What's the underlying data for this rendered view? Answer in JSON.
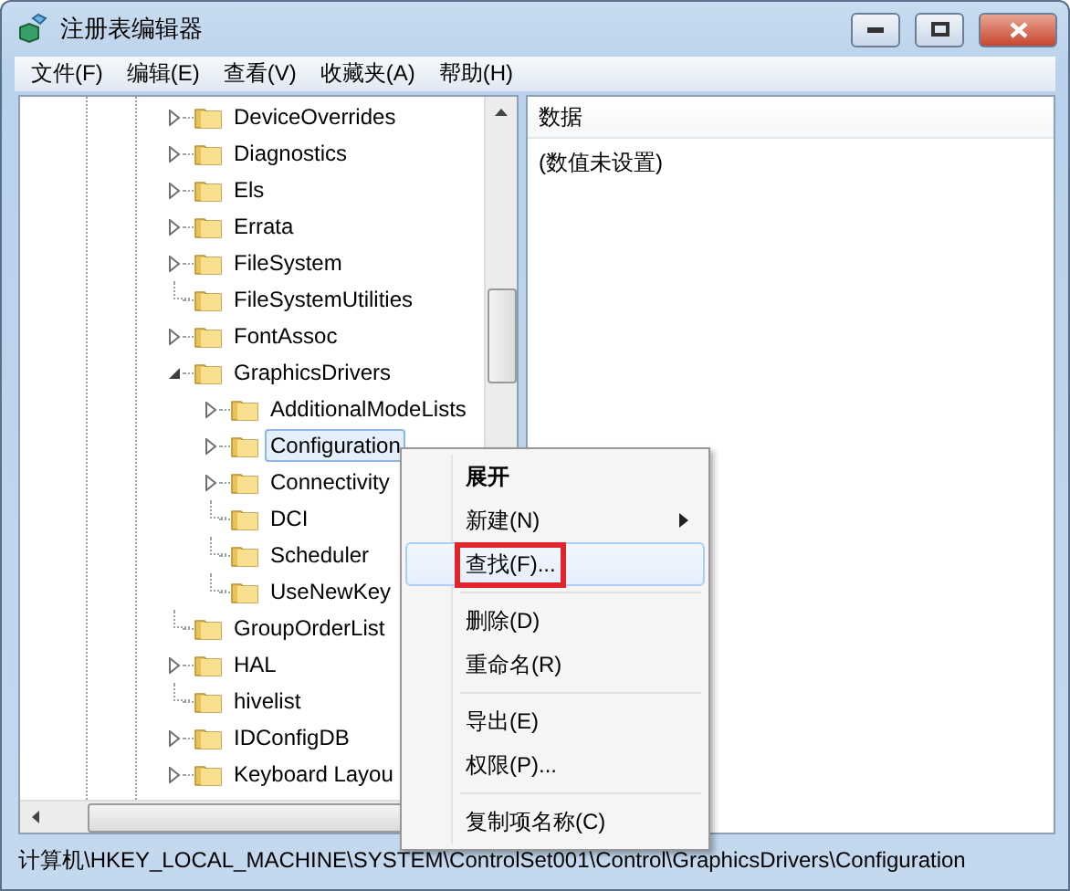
{
  "window": {
    "title": "注册表编辑器"
  },
  "menu_bar": [
    {
      "label": "文件(F)"
    },
    {
      "label": "编辑(E)"
    },
    {
      "label": "查看(V)"
    },
    {
      "label": "收藏夹(A)"
    },
    {
      "label": "帮助(H)"
    }
  ],
  "tree": [
    {
      "label": "DeviceOverrides",
      "kind": "collapsed",
      "selected": false
    },
    {
      "label": "Diagnostics",
      "kind": "collapsed",
      "selected": false
    },
    {
      "label": "Els",
      "kind": "collapsed",
      "selected": false
    },
    {
      "label": "Errata",
      "kind": "collapsed",
      "selected": false
    },
    {
      "label": "FileSystem",
      "kind": "collapsed",
      "selected": false
    },
    {
      "label": "FileSystemUtilities",
      "kind": "leaf",
      "selected": false
    },
    {
      "label": "FontAssoc",
      "kind": "collapsed",
      "selected": false
    },
    {
      "label": "GraphicsDrivers",
      "kind": "expanded",
      "selected": false,
      "children": [
        {
          "label": "AdditionalModeLists",
          "kind": "collapsed",
          "selected": false
        },
        {
          "label": "Configuration",
          "kind": "collapsed",
          "selected": true
        },
        {
          "label": "Connectivity",
          "kind": "collapsed",
          "selected": false
        },
        {
          "label": "DCI",
          "kind": "leaf",
          "selected": false
        },
        {
          "label": "Scheduler",
          "kind": "leaf",
          "selected": false
        },
        {
          "label": "UseNewKey",
          "kind": "leaf",
          "selected": false
        }
      ]
    },
    {
      "label": "GroupOrderList",
      "kind": "leaf",
      "selected": false
    },
    {
      "label": "HAL",
      "kind": "collapsed",
      "selected": false
    },
    {
      "label": "hivelist",
      "kind": "leaf",
      "selected": false
    },
    {
      "label": "IDConfigDB",
      "kind": "collapsed",
      "selected": false
    },
    {
      "label": "Keyboard Layou",
      "kind": "collapsed",
      "selected": false
    }
  ],
  "values_pane": {
    "column_header": "数据",
    "value": "(数值未设置)"
  },
  "context_menu": [
    {
      "label": "展开",
      "kind": "default",
      "selected": false,
      "annotated": false
    },
    {
      "label": "新建(N)",
      "kind": "submenu",
      "selected": false,
      "annotated": false
    },
    {
      "label": "查找(F)...",
      "kind": "item",
      "selected": true,
      "annotated": true
    },
    {
      "kind": "separator"
    },
    {
      "label": "删除(D)",
      "kind": "item",
      "selected": false,
      "annotated": false
    },
    {
      "label": "重命名(R)",
      "kind": "item",
      "selected": false,
      "annotated": false
    },
    {
      "kind": "separator"
    },
    {
      "label": "导出(E)",
      "kind": "item",
      "selected": false,
      "annotated": false
    },
    {
      "label": "权限(P)...",
      "kind": "item",
      "selected": false,
      "annotated": false
    },
    {
      "kind": "separator"
    },
    {
      "label": "复制项名称(C)",
      "kind": "item",
      "selected": false,
      "annotated": false
    }
  ],
  "status_bar": "计算机\\HKEY_LOCAL_MACHINE\\SYSTEM\\ControlSet001\\Control\\GraphicsDrivers\\Configuration"
}
